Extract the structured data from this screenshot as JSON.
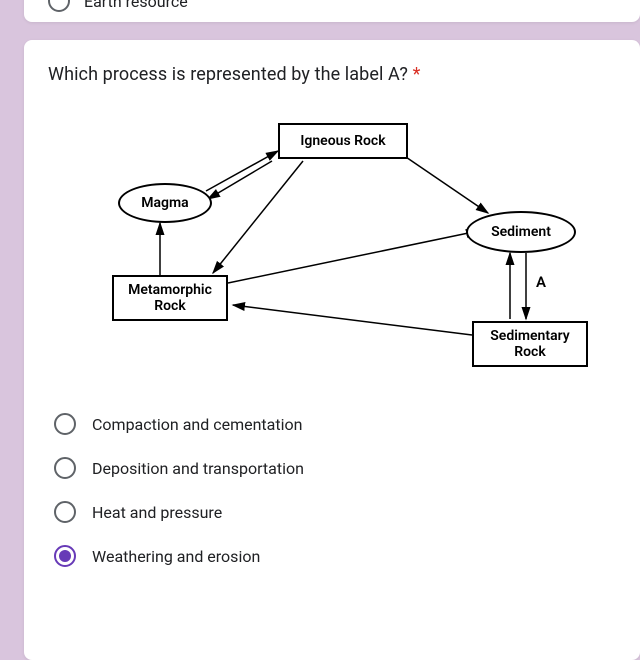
{
  "prev_card": {
    "visible_option": "Earth resource"
  },
  "question": {
    "text": "Which process is represented by the label A?",
    "required_marker": "*"
  },
  "diagram": {
    "nodes": {
      "igneous": "Igneous Rock",
      "magma": "Magma",
      "sediment": "Sediment",
      "metamorphic": "Metamorphic\nRock",
      "sedimentary": "Sedimentary\nRock"
    },
    "label_a": "A"
  },
  "options": [
    {
      "label": "Compaction and cementation",
      "checked": false
    },
    {
      "label": "Deposition and transportation",
      "checked": false
    },
    {
      "label": "Heat and pressure",
      "checked": false
    },
    {
      "label": "Weathering and erosion",
      "checked": true
    }
  ]
}
